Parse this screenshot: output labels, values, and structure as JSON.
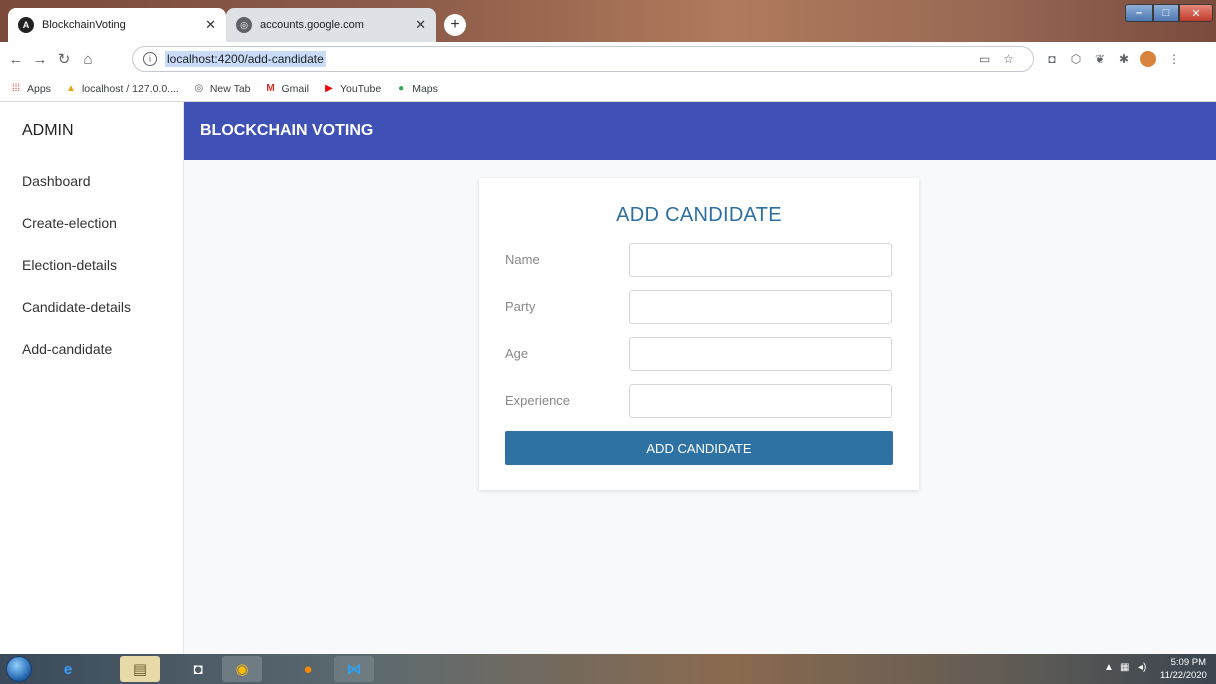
{
  "browser": {
    "tabs": [
      {
        "title": "BlockchainVoting",
        "active": true
      },
      {
        "title": "accounts.google.com",
        "active": false
      }
    ],
    "url": "localhost:4200/add-candidate",
    "bookmarks": [
      {
        "label": "Apps",
        "icon": "apps-grid-icon"
      },
      {
        "label": "localhost / 127.0.0....",
        "icon": "phpmyadmin-icon"
      },
      {
        "label": "New Tab",
        "icon": "globe-icon"
      },
      {
        "label": "Gmail",
        "icon": "gmail-icon"
      },
      {
        "label": "YouTube",
        "icon": "youtube-icon"
      },
      {
        "label": "Maps",
        "icon": "maps-pin-icon"
      }
    ]
  },
  "sidebar": {
    "title": "ADMIN",
    "items": [
      {
        "label": "Dashboard"
      },
      {
        "label": "Create-election"
      },
      {
        "label": "Election-details"
      },
      {
        "label": "Candidate-details"
      },
      {
        "label": "Add-candidate"
      }
    ]
  },
  "header": {
    "title": "BLOCKCHAIN VOTING",
    "color": "#3f51b5"
  },
  "form": {
    "title": "ADD CANDIDATE",
    "fields": [
      {
        "label": "Name",
        "value": ""
      },
      {
        "label": "Party",
        "value": ""
      },
      {
        "label": "Age",
        "value": ""
      },
      {
        "label": "Experience",
        "value": ""
      }
    ],
    "submit_label": "ADD CANDIDATE",
    "submit_color": "#2d72a3"
  },
  "taskbar": {
    "time": "5:09 PM",
    "date": "11/22/2020"
  }
}
